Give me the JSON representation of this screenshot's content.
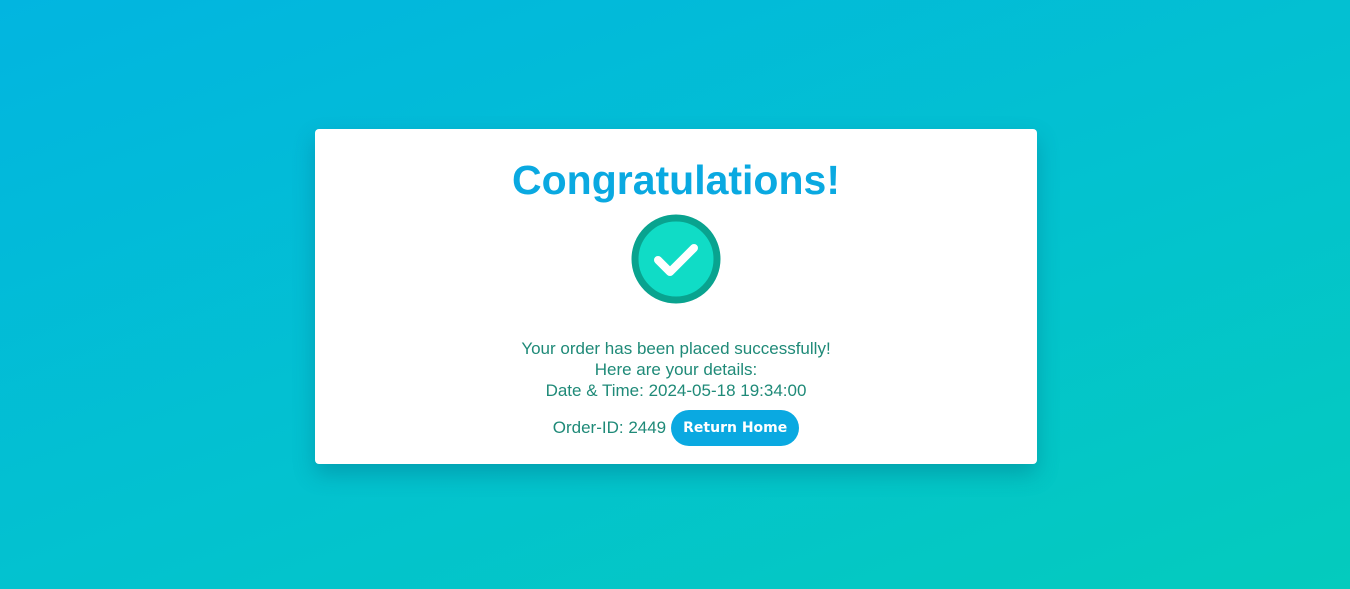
{
  "card": {
    "title": "Congratulations!",
    "icon": "check-circle-icon",
    "message_line1": "Your order has been placed successfully!",
    "message_line2": "Here are your details:",
    "datetime_label": "Date & Time:",
    "datetime_value": "2024-05-18 19:34:00",
    "order_label": "Order-ID:",
    "order_value": "2449",
    "return_button_label": "Return Home"
  },
  "colors": {
    "accent": "#0aa9e1",
    "text": "#1f8a78",
    "check_fill": "#10dcc6",
    "check_ring": "#09a38f"
  }
}
